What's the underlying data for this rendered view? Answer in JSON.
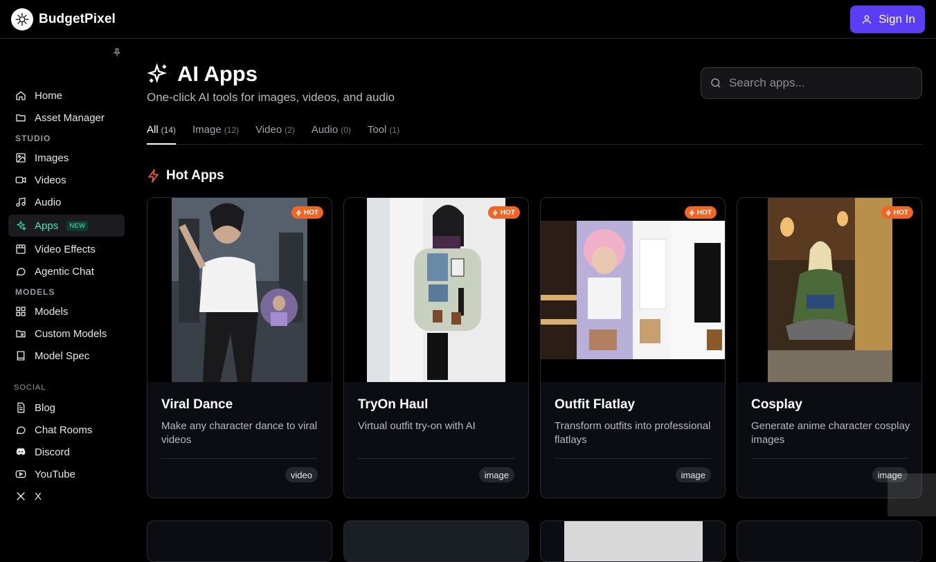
{
  "brand": {
    "name": "BudgetPixel"
  },
  "header": {
    "signin_label": "Sign In"
  },
  "sidebar": {
    "items_top": [
      {
        "label": "Home",
        "icon": "home-icon"
      },
      {
        "label": "Asset Manager",
        "icon": "folder-icon"
      }
    ],
    "studio_label": "STUDIO",
    "studio": [
      {
        "label": "Images",
        "icon": "image-icon"
      },
      {
        "label": "Videos",
        "icon": "video-icon"
      },
      {
        "label": "Audio",
        "icon": "music-icon"
      },
      {
        "label": "Apps",
        "icon": "sparkles-icon",
        "badge": "NEW",
        "active": true
      },
      {
        "label": "Video Effects",
        "icon": "film-icon"
      },
      {
        "label": "Agentic Chat",
        "icon": "chat-icon"
      }
    ],
    "models_label": "MODELS",
    "models": [
      {
        "label": "Models",
        "icon": "grid-icon"
      },
      {
        "label": "Custom Models",
        "icon": "folder-search-icon"
      },
      {
        "label": "Model Spec",
        "icon": "book-icon"
      }
    ],
    "social_label": "SOCIAL",
    "social": [
      {
        "label": "Blog",
        "icon": "blog-icon"
      },
      {
        "label": "Chat Rooms",
        "icon": "chat-icon"
      },
      {
        "label": "Discord",
        "icon": "discord-icon"
      },
      {
        "label": "YouTube",
        "icon": "youtube-icon"
      },
      {
        "label": "X",
        "icon": "x-icon"
      }
    ]
  },
  "main": {
    "title": "AI Apps",
    "subtitle": "One-click AI tools for images, videos, and audio",
    "search_placeholder": "Search apps...",
    "tabs": [
      {
        "label": "All",
        "count": "(14)",
        "active": true
      },
      {
        "label": "Image",
        "count": "(12)"
      },
      {
        "label": "Video",
        "count": "(2)"
      },
      {
        "label": "Audio",
        "count": "(0)"
      },
      {
        "label": "Tool",
        "count": "(1)"
      }
    ],
    "hot_section_title": "Hot Apps",
    "hot_badge": "HOT",
    "cards": [
      {
        "title": "Viral Dance",
        "desc": "Make any character dance to viral videos",
        "tag": "video"
      },
      {
        "title": "TryOn Haul",
        "desc": "Virtual outfit try-on with AI",
        "tag": "image"
      },
      {
        "title": "Outfit Flatlay",
        "desc": "Transform outfits into professional flatlays",
        "tag": "image"
      },
      {
        "title": "Cosplay",
        "desc": "Generate anime character cosplay images",
        "tag": "image"
      }
    ]
  },
  "colors": {
    "accent": "#5b3df5",
    "active": "#22d3a6",
    "hot": "#f26522"
  }
}
